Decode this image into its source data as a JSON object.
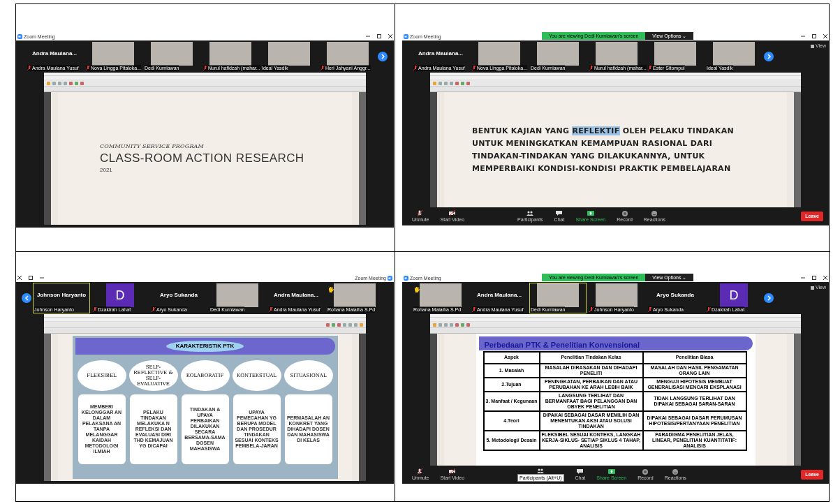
{
  "panels": [
    {
      "title": "Zoom Meeting",
      "mirrored": false,
      "scroll_left": false,
      "participants": [
        {
          "name": "Andra Maulana Yusuf",
          "big_name": "Andra  Maulana...",
          "muted": true,
          "video": false,
          "hand": false,
          "active": false
        },
        {
          "name": "Nova Lingga Pitaloka...",
          "muted": true,
          "video": true,
          "hand": false,
          "active": false
        },
        {
          "name": "Dedi Kurniawan",
          "muted": false,
          "video": true,
          "hand": false,
          "active": false
        },
        {
          "name": "Nurul hafidzah (mahar...",
          "muted": true,
          "video": true,
          "hand": false,
          "active": false
        },
        {
          "name": "Ideal Yasdik",
          "muted": false,
          "video": true,
          "hand": false,
          "active": false
        },
        {
          "name": "Heri Jahyani Anggr...",
          "muted": true,
          "video": true,
          "hand": false,
          "active": false
        }
      ],
      "slide": {
        "kind": "title",
        "subtitle": "COMMUNITY SERVICE PROGRAM",
        "heading": "CLASS-ROOM ACTION RESEARCH",
        "year": "2021"
      }
    },
    {
      "title": "Zoom Meeting",
      "mirrored": false,
      "scroll_left": false,
      "banner": {
        "text": "You are viewing Dedi Kurniawan's screen",
        "button": "View Options ⌄"
      },
      "view_label": "View",
      "participants": [
        {
          "name": "Andra Maulana Yusuf",
          "big_name": "Andra  Maulana...",
          "muted": true,
          "video": false,
          "hand": false,
          "active": false
        },
        {
          "name": "Nova Lingga Pitaloka...",
          "muted": true,
          "video": true,
          "hand": false,
          "active": false
        },
        {
          "name": "Dedi Kurniawan",
          "muted": false,
          "video": true,
          "hand": false,
          "active": false
        },
        {
          "name": "Nurul hafidzah (mahar...",
          "muted": true,
          "video": true,
          "hand": false,
          "active": false
        },
        {
          "name": "Ester Sitompul",
          "muted": true,
          "video": true,
          "hand": false,
          "active": false
        },
        {
          "name": "Ideal Yasdik",
          "muted": false,
          "video": true,
          "hand": false,
          "active": false
        }
      ],
      "slide": {
        "kind": "text",
        "segments": [
          {
            "text": "BENTUK KAJIAN YANG ",
            "highlighted": false
          },
          {
            "text": "REFLEKTIF",
            "highlighted": true
          },
          {
            "text": " OLEH PELAKU TINDAKAN UNTUK MENINGKATKAN KEMAMPUAN RASIONAL DARI TINDAKAN-TINDAKAN YANG DILAKUKANNYA, UNTUK MEMPERBAIKI KONDISI-KONDISI PRAKTIK PEMBELAJARAN",
            "highlighted": false
          }
        ]
      },
      "toolbar": {
        "items": [
          {
            "kind": "mic",
            "label": "Unmute"
          },
          {
            "kind": "video",
            "label": "Start Video"
          },
          {
            "kind": "participants",
            "label": "Participants"
          },
          {
            "kind": "chat",
            "label": "Chat"
          },
          {
            "kind": "share",
            "label": "Share Screen"
          },
          {
            "kind": "record",
            "label": "Record"
          },
          {
            "kind": "reactions",
            "label": "Reactions"
          }
        ],
        "leave": "Leave"
      }
    },
    {
      "title": "Zoom Meeting",
      "mirrored": true,
      "scroll_left": true,
      "participants": [
        {
          "name": "Johnson Haryanto",
          "big_name": "Johnson Haryanto",
          "muted": false,
          "video": false,
          "hand": false,
          "active": true
        },
        {
          "name": "Dzakirah Lahat",
          "avatar_letter": "D",
          "muted": true,
          "video": false,
          "hand": false,
          "active": false
        },
        {
          "name": "Aryo Sukanda",
          "big_name": "Aryo Sukanda",
          "muted": true,
          "video": false,
          "hand": false,
          "active": false
        },
        {
          "name": "Dedi Kurniawan",
          "muted": false,
          "video": true,
          "hand": false,
          "active": false
        },
        {
          "name": "Andra Maulana Yusuf",
          "big_name": "Andra  Maulana...",
          "muted": true,
          "video": false,
          "hand": false,
          "active": false
        },
        {
          "name": "Rohana Malaiha S.Pd",
          "muted": false,
          "video": true,
          "hand": true,
          "active": false
        }
      ],
      "slide": {
        "kind": "diagram",
        "title": "KARAKTERISTIK PTK",
        "columns": [
          {
            "heading": "FLEKSIBEL",
            "body": "MEMBERI KELONGGAR AN DALAM PELAKSANA AN TANPA MELANGGAR KAIDAH METODOLOGI ILMIAH"
          },
          {
            "heading": "SELF-REFLECTIVE & SELF-EVALUATIVE",
            "body": "PELAKU TINDAKAN MELAKUKA N REFLEKSI DAN EVALUASI DIRI THD KEMAJUAN YG DICAPAI"
          },
          {
            "heading": "KOLABORATIF",
            "body": "TINDAKAN & UPAYA PERBAIKAN DILAKUKAN SECARA BERSAMA-SAMA DOSEN MAHASISWA"
          },
          {
            "heading": "KONTEKSTUAL",
            "body": "UPAYA PEMECAHAN YG BERUPA MODEL DAN PROSEDUR TINDAKAN SESUAI KONTEKS PEMBELA-JARAN"
          },
          {
            "heading": "SITUASIONAL",
            "body": "PERMASALAH AN KONKRET YANG DIHADAPI DOSEN DAN MAHASISWA DI KELAS"
          }
        ]
      }
    },
    {
      "title": "Zoom Meeting",
      "mirrored": false,
      "scroll_left": false,
      "banner": {
        "text": "You are viewing Dedi Kurniawan's screen",
        "button": "View Options ⌄"
      },
      "view_label": "View",
      "participants": [
        {
          "name": "Rohana Malaiha S.Pd",
          "muted": false,
          "video": true,
          "hand": true,
          "active": false
        },
        {
          "name": "Andra Maulana Yusuf",
          "big_name": "Andra  Maulana...",
          "muted": true,
          "video": false,
          "hand": false,
          "active": false
        },
        {
          "name": "Dedi Kurniawan",
          "muted": false,
          "video": true,
          "hand": false,
          "active": true
        },
        {
          "name": "Johnson Haryanto",
          "muted": true,
          "video": true,
          "hand": false,
          "active": false
        },
        {
          "name": "Aryo Sukanda",
          "big_name": "Aryo Sukanda",
          "muted": true,
          "video": false,
          "hand": false,
          "active": false
        },
        {
          "name": "Dzakirah Lahat",
          "avatar_letter": "D",
          "muted": true,
          "video": false,
          "hand": false,
          "active": false
        }
      ],
      "slide": {
        "kind": "table",
        "title": "Perbedaan PTK & Penelitian Konvensional",
        "columns": [
          "Aspek",
          "Penelitian Tindakan Kelas",
          "Penelitian Biasa"
        ],
        "rows": [
          [
            "1.    Masalah",
            "MASALAH DIRASAKAN DAN DIHADAPI PENELITI",
            "MASALAH DAN HASIL PENGAMATAN ORANG LAIN"
          ],
          [
            "2.Tujuan",
            "PENINGKATAN, PERBAIKAN DAN ATAU PERUBAHAN KE ARAH LEBIH BAIK",
            "MENGUJI HIPOTESIS MEMBUAT GENERALISASI MENCARI EKSPLANASI"
          ],
          [
            "3.    Manfaat / Kegunaan",
            "LANGSUNG TERLIHAT DAN BERMANFAAT BAGI PELANGGAN DAN OBYEK PENELITIAN",
            "TIDAK LANGSUNG TERLIHAT DAN DIPAKAI SEBAGAI SARAN-SARAN"
          ],
          [
            "4.Teori",
            "DIPAKAI SEBAGAI DASAR MEMILIH DAN MENENTUKAN AKSI ATAU SOLUSI TINDAKAN",
            "DIPAKAI SEBAGAI DASAR PERUMUSAN HIPOTESIS/PERTANYAAN PENELITIAN"
          ],
          [
            "5.    Metodologi/ Desain",
            "FLEKSIBEL SESUAI KONTEKS, LANGKAH KERJA-SIKLUS- SETIAP SIKLUS 4 TAHAP, ANALISIS",
            "PARADIGMA PENELITIAN JELAS, LINEAR, PENELITIAN KUANTITATIF: ANALISIS"
          ]
        ]
      },
      "toolbar": {
        "items": [
          {
            "kind": "mic",
            "label": "Unmute"
          },
          {
            "kind": "video",
            "label": "Start Video"
          },
          {
            "kind": "participants",
            "tooltip": "Participants (Alt+U)"
          },
          {
            "kind": "chat",
            "label": "Chat"
          },
          {
            "kind": "share",
            "label": "Share Screen"
          },
          {
            "kind": "record",
            "label": "Record"
          },
          {
            "kind": "reactions",
            "label": "Reactions"
          }
        ],
        "leave": "Leave"
      }
    }
  ]
}
